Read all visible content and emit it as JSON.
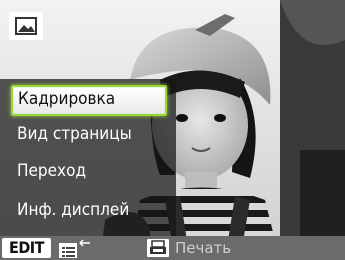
{
  "menu": {
    "items": [
      {
        "label": "Кадрировка",
        "selected": true
      },
      {
        "label": "Вид страницы",
        "selected": false
      },
      {
        "label": "Переход",
        "selected": false
      },
      {
        "label": "Инф. дисплей",
        "selected": false
      }
    ]
  },
  "bottom_bar": {
    "edit_label": "EDIT",
    "print_label": "Печать"
  },
  "icons": {
    "mode": "image-mode-icon",
    "list": "list-return-icon",
    "print": "print-icon"
  },
  "colors": {
    "highlight_border": "#9ad53b",
    "panel": "#161616",
    "bottom_bar": "#6b6b6b"
  }
}
